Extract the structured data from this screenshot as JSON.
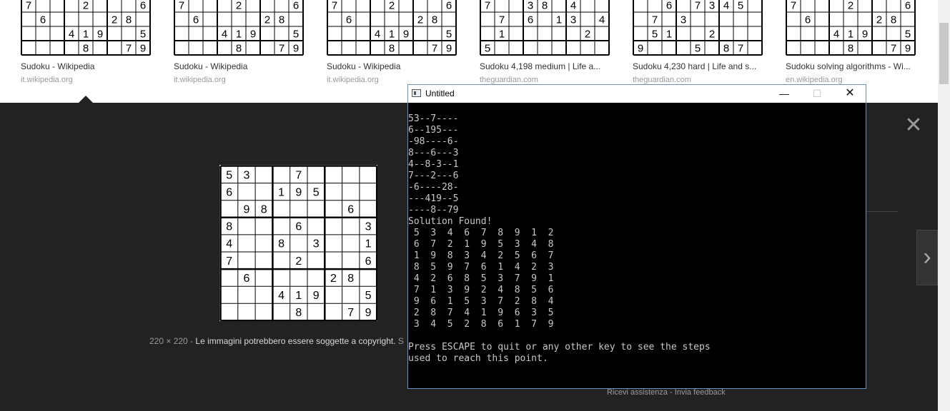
{
  "results": [
    {
      "title": "Sudoku - Wikipedia",
      "source": "it.wikipedia.org",
      "rows": [
        [
          "7",
          "",
          "",
          "",
          "2",
          "",
          "",
          "",
          "6"
        ],
        [
          "",
          "6",
          "",
          "",
          "",
          "",
          "2",
          "8",
          ""
        ],
        [
          "",
          "",
          "",
          "4",
          "1",
          "9",
          "",
          "",
          "5"
        ],
        [
          "",
          "",
          "",
          "",
          "8",
          "",
          "",
          "7",
          "9"
        ]
      ]
    },
    {
      "title": "Sudoku - Wikipedia",
      "source": "it.wikipedia.org",
      "rows": [
        [
          "7",
          "",
          "",
          "",
          "2",
          "",
          "",
          "",
          "6"
        ],
        [
          "",
          "6",
          "",
          "",
          "",
          "",
          "2",
          "8",
          ""
        ],
        [
          "",
          "",
          "",
          "4",
          "1",
          "9",
          "",
          "",
          "5"
        ],
        [
          "",
          "",
          "",
          "",
          "8",
          "",
          "",
          "7",
          "9"
        ]
      ]
    },
    {
      "title": "Sudoku - Wikipedia",
      "source": "it.wikipedia.org",
      "rows": [
        [
          "7",
          "",
          "",
          "",
          "2",
          "",
          "",
          "",
          "6"
        ],
        [
          "",
          "6",
          "",
          "",
          "",
          "",
          "2",
          "8",
          ""
        ],
        [
          "",
          "",
          "",
          "4",
          "1",
          "9",
          "",
          "",
          "5"
        ],
        [
          "",
          "",
          "",
          "",
          "8",
          "",
          "",
          "7",
          "9"
        ]
      ]
    },
    {
      "title": "Sudoku 4,198 medium | Life a...",
      "source": "theguardian.com",
      "rows": [
        [
          "7",
          "",
          "",
          "3",
          "8",
          "",
          "4",
          "",
          ""
        ],
        [
          "",
          "7",
          "",
          "6",
          "",
          "1",
          "3",
          "",
          "4"
        ],
        [
          "",
          "1",
          "",
          "",
          "",
          "",
          "",
          "2",
          ""
        ],
        [
          "5",
          "",
          "",
          "",
          "",
          "",
          "",
          "",
          ""
        ]
      ]
    },
    {
      "title": "Sudoku 4,230 hard | Life and s...",
      "source": "theguardian.com",
      "rows": [
        [
          "",
          "",
          "6",
          "",
          "7",
          "3",
          "4",
          "5",
          ""
        ],
        [
          "",
          "7",
          "",
          "3",
          "",
          "",
          "",
          "",
          ""
        ],
        [
          "",
          "5",
          "1",
          "",
          "",
          "2",
          "",
          "",
          ""
        ],
        [
          "9",
          "",
          "",
          "",
          "5",
          "",
          "8",
          "7",
          ""
        ]
      ]
    },
    {
      "title": "Sudoku solving algorithms - Wi...",
      "source": "en.wikipedia.org",
      "rows": [
        [
          "7",
          "",
          "",
          "",
          "2",
          "",
          "",
          "",
          "6"
        ],
        [
          "",
          "6",
          "",
          "",
          "",
          "",
          "2",
          "8",
          ""
        ],
        [
          "",
          "",
          "",
          "4",
          "1",
          "9",
          "",
          "",
          "5"
        ],
        [
          "",
          "",
          "",
          "",
          "8",
          "",
          "",
          "7",
          "9"
        ]
      ]
    }
  ],
  "preview": {
    "close_glyph": "✕",
    "next_glyph": "›",
    "grid": [
      [
        "5",
        "3",
        "",
        "",
        "7",
        "",
        "",
        "",
        ""
      ],
      [
        "6",
        "",
        "",
        "1",
        "9",
        "5",
        "",
        "",
        ""
      ],
      [
        "",
        "9",
        "8",
        "",
        "",
        "",
        "",
        "6",
        ""
      ],
      [
        "8",
        "",
        "",
        "",
        "6",
        "",
        "",
        "",
        "3"
      ],
      [
        "4",
        "",
        "",
        "8",
        "",
        "3",
        "",
        "",
        "1"
      ],
      [
        "7",
        "",
        "",
        "",
        "2",
        "",
        "",
        "",
        "6"
      ],
      [
        "",
        "6",
        "",
        "",
        "",
        "",
        "2",
        "8",
        ""
      ],
      [
        "",
        "",
        "",
        "4",
        "1",
        "9",
        "",
        "",
        "5"
      ],
      [
        "",
        "",
        "",
        "",
        "8",
        "",
        "",
        "7",
        "9"
      ]
    ],
    "dimensions": "220 × 220",
    "separator": " - ",
    "copyright": "Le immagini potrebbero essere soggette a copyright.",
    "copyright_tail": " S",
    "help_link": "Ricevi assistenza",
    "feedback_link": "Invia feedback",
    "links_separator": " - "
  },
  "console": {
    "title": "Untitled",
    "minimize_glyph": "—",
    "maximize_glyph": "☐",
    "close_glyph": "✕",
    "output": "53--7----\n6--195---\n-98----6-\n8---6---3\n4--8-3--1\n7---2---6\n-6----28-\n---419--5\n----8--79\nSolution Found!\n 5  3  4  6  7  8  9  1  2\n 6  7  2  1  9  5  3  4  8\n 1  9  8  3  4  2  5  6  7\n 8  5  9  7  6  1  4  2  3\n 4  2  6  8  5  3  7  9  1\n 7  1  3  9  2  4  8  5  6\n 9  6  1  5  3  7  2  8  4\n 2  8  7  4  1  9  6  3  5\n 3  4  5  2  8  6  1  7  9\n\nPress ESCAPE to quit or any other key to see the steps\nused to reach this point."
  }
}
